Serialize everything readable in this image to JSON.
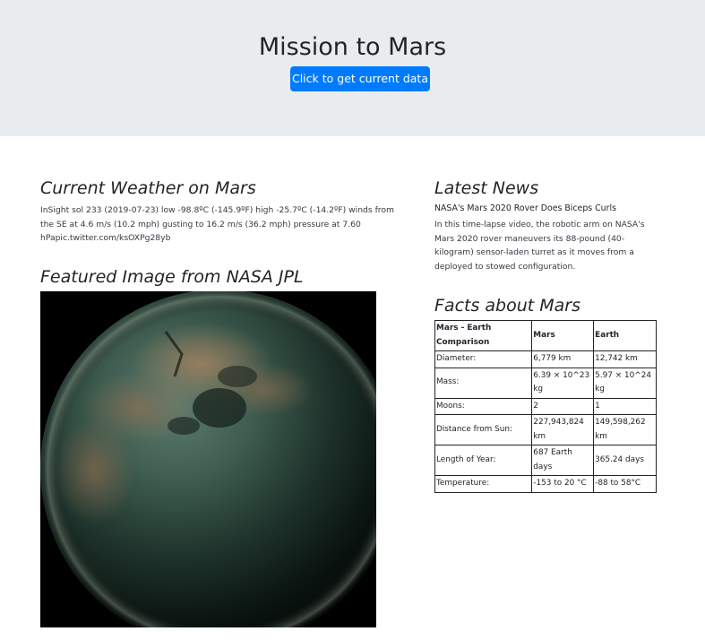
{
  "header": {
    "title": "Mission to Mars",
    "button_label": "Click to get current data"
  },
  "weather": {
    "heading": "Current Weather on Mars",
    "text": "InSight sol 233 (2019-07-23) low -98.8ºC (-145.9ºF) high -25.7ºC (-14.2ºF) winds from the SE at 4.6 m/s (10.2 mph) gusting to 16.2 m/s (36.2 mph) pressure at 7.60 hPapic.twitter.com/ksOXPg28yb"
  },
  "featured_image": {
    "heading": "Featured Image from NASA JPL",
    "alt": "Saturn moon Titan in infrared"
  },
  "news": {
    "heading": "Latest News",
    "title": "NASA's Mars 2020 Rover Does Biceps Curls",
    "teaser": "In this time-lapse video, the robotic arm on NASA's Mars 2020 rover maneuvers its 88-pound (40-kilogram) sensor-laden turret as it moves from a deployed to stowed configuration."
  },
  "facts": {
    "heading": "Facts about Mars",
    "columns": [
      "Mars - Earth Comparison",
      "Mars",
      "Earth"
    ],
    "rows": [
      [
        "Diameter:",
        "6,779 km",
        "12,742 km"
      ],
      [
        "Mass:",
        "6.39 × 10^23 kg",
        "5.97 × 10^24 kg"
      ],
      [
        "Moons:",
        "2",
        "1"
      ],
      [
        "Distance from Sun:",
        "227,943,824 km",
        "149,598,262 km"
      ],
      [
        "Length of Year:",
        "687 Earth days",
        "365.24 days"
      ],
      [
        "Temperature:",
        "-153 to 20 °C",
        "-88 to 58°C"
      ]
    ]
  }
}
